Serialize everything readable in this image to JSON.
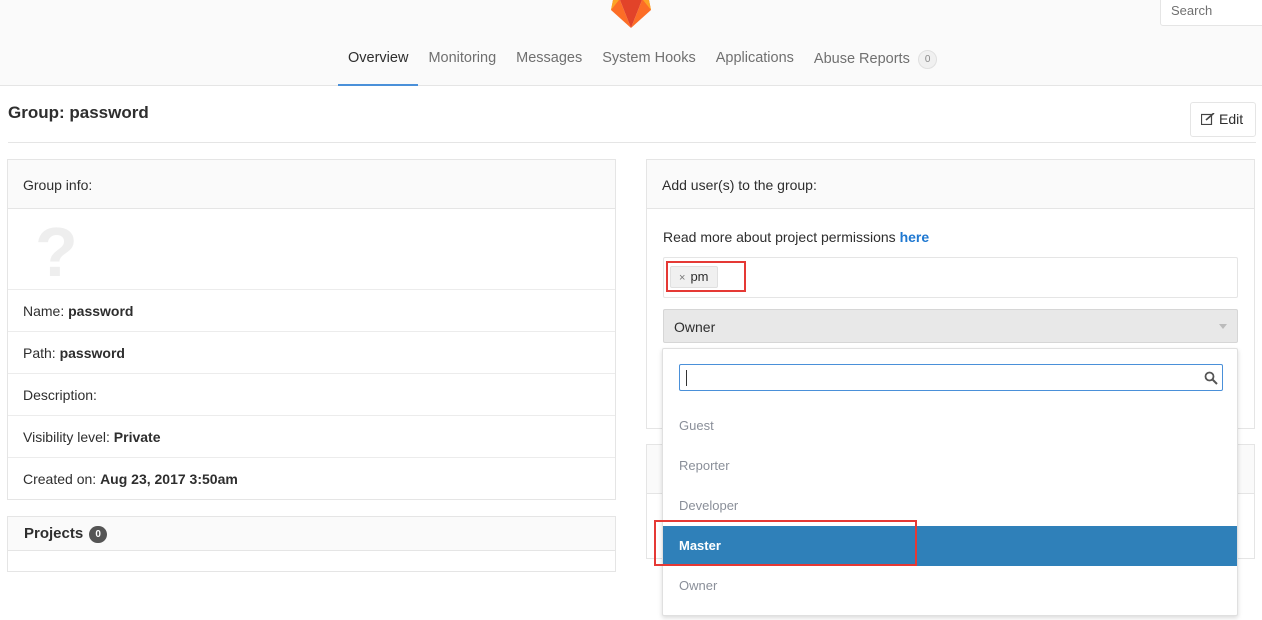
{
  "header": {
    "search_placeholder": "Search",
    "tabs": [
      {
        "label": "Overview",
        "active": true
      },
      {
        "label": "Monitoring"
      },
      {
        "label": "Messages"
      },
      {
        "label": "System Hooks"
      },
      {
        "label": "Applications"
      },
      {
        "label": "Abuse Reports",
        "badge": "0"
      }
    ]
  },
  "page": {
    "title": "Group: password",
    "edit_label": "Edit"
  },
  "group_info": {
    "heading": "Group info:",
    "avatar_glyph": "?",
    "name_label": "Name:",
    "name_value": "password",
    "path_label": "Path:",
    "path_value": "password",
    "description_label": "Description:",
    "visibility_label": "Visibility level:",
    "visibility_value": "Private",
    "created_label": "Created on:",
    "created_value": "Aug 23, 2017 3:50am"
  },
  "projects": {
    "heading": "Projects",
    "count": "0"
  },
  "add_users": {
    "heading": "Add user(s) to the group:",
    "perm_text": "Read more about project permissions",
    "perm_link": "here",
    "selected_user": "pm",
    "chip_remove": "×",
    "role_value": "Owner"
  },
  "role_dropdown": {
    "search_value": "",
    "options": [
      {
        "label": "Guest"
      },
      {
        "label": "Reporter"
      },
      {
        "label": "Developer"
      },
      {
        "label": "Master",
        "highlighted": true
      },
      {
        "label": "Owner"
      }
    ]
  },
  "colors": {
    "accent": "#4a90d9",
    "link": "#1f78d1",
    "highlight": "#2f80b9",
    "annotation": "#e53935"
  }
}
